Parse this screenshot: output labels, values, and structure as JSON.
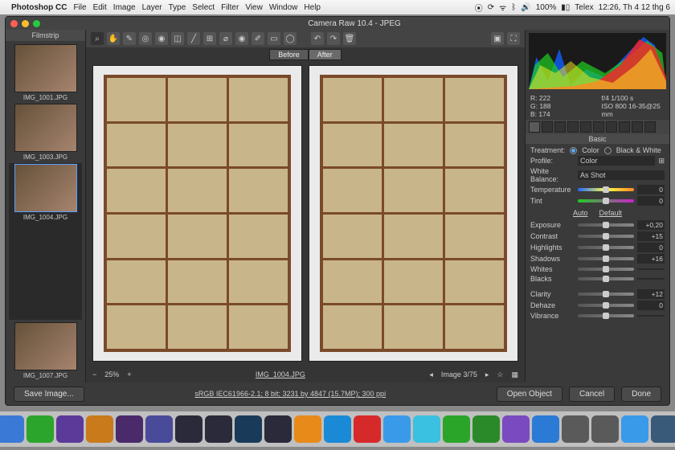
{
  "mac": {
    "app": "Photoshop CC",
    "menus": [
      "File",
      "Edit",
      "Image",
      "Layer",
      "Type",
      "Select",
      "Filter",
      "View",
      "Window",
      "Help"
    ],
    "battery": "100%",
    "input": "Telex",
    "time": "12:26, Th 4 12 thg 6"
  },
  "window": {
    "title": "Camera Raw 10.4  -  JPEG"
  },
  "filmstrip": {
    "label": "Filmstrip",
    "items": [
      {
        "name": "IMG_1001.JPG"
      },
      {
        "name": "IMG_1003.JPG"
      },
      {
        "name": "IMG_1004.JPG",
        "selected": true
      },
      {
        "name": "IMG_1007.JPG"
      }
    ]
  },
  "ba": {
    "before": "Before",
    "after": "After"
  },
  "bottom_center": {
    "zoom": "25%",
    "filename": "IMG_1004.JPG",
    "pager": "Image 3/75"
  },
  "panel": {
    "title": "Basic",
    "readout": {
      "r": "R:  222",
      "g": "G:  188",
      "b": "B:  174",
      "ap": "f/4     1/100 s",
      "iso": "ISO 800    16-35@25 mm"
    },
    "treatment_label": "Treatment:",
    "color": "Color",
    "bw": "Black & White",
    "profile_label": "Profile:",
    "profile_value": "Color",
    "wb_label": "White Balance:",
    "wb_value": "As Shot",
    "temp_label": "Temperature",
    "temp_val": "0",
    "tint_label": "Tint",
    "tint_val": "0",
    "auto": "Auto",
    "default": "Default",
    "sliders": [
      {
        "label": "Exposure",
        "val": "+0,20"
      },
      {
        "label": "Contrast",
        "val": "+15"
      },
      {
        "label": "Highlights",
        "val": "0"
      },
      {
        "label": "Shadows",
        "val": "+16"
      },
      {
        "label": "Whites",
        "val": ""
      },
      {
        "label": "Blacks",
        "val": ""
      },
      {
        "label": "Clarity",
        "val": "+12"
      },
      {
        "label": "Dehaze",
        "val": "0"
      },
      {
        "label": "Vibrance",
        "val": ""
      }
    ]
  },
  "footer": {
    "save": "Save Image...",
    "info": "sRGB IEC61966-2.1; 8 bit; 3231 by 4847 (15.7MP); 300 ppi",
    "open": "Open Object",
    "cancel": "Cancel",
    "done": "Done"
  },
  "dock_colors": [
    "#2a66c8",
    "#8a8a8a",
    "#3a7ad6",
    "#2ca52c",
    "#5c3a9a",
    "#c97a1a",
    "#4a2a6a",
    "#4a4a9a",
    "#2a2a3a",
    "#2a2a3a",
    "#1a3a5a",
    "#2a2a3a",
    "#e78a1a",
    "#1a8ad6",
    "#d62a2a",
    "#3a9aea",
    "#3ac0e0",
    "#2aa52a",
    "#2a8a2a",
    "#7a4ac0",
    "#2a7ad6",
    "#5a5a5a",
    "#5a5a5a",
    "#3a9aea",
    "#3a5a7a",
    "#c9b58a",
    "#888"
  ]
}
